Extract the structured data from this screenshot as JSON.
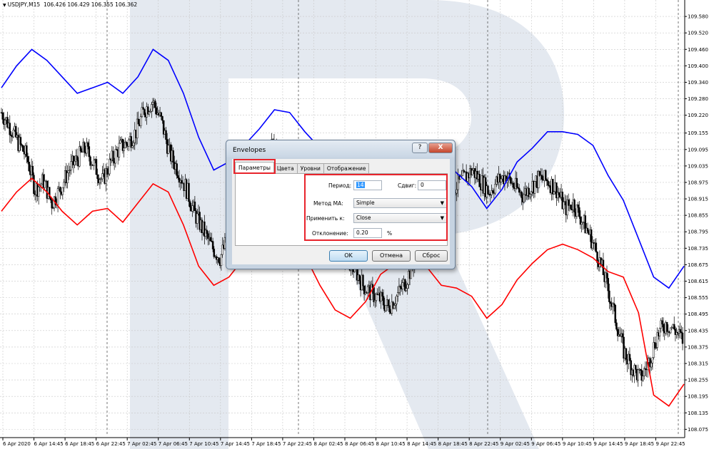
{
  "chart": {
    "symbol": "USDJPY,M15",
    "ohlc": "106.426 106.429 106.355 106.362",
    "colors": {
      "upper_band": "#0000ff",
      "lower_band": "#ff0000",
      "candles": "#000000",
      "grid": "#c8c8c8"
    }
  },
  "chart_data": {
    "type": "line",
    "ylim": [
      108.05,
      109.64
    ],
    "price_ticks": [
      "109.580",
      "109.520",
      "109.460",
      "109.400",
      "109.340",
      "109.280",
      "109.220",
      "109.155",
      "109.095",
      "109.035",
      "108.975",
      "108.915",
      "108.855",
      "108.795",
      "108.735",
      "108.675",
      "108.615",
      "108.555",
      "108.495",
      "108.435",
      "108.375",
      "108.315",
      "108.255",
      "108.195",
      "108.135",
      "108.075"
    ],
    "time_ticks": [
      "6 Apr 2020",
      "6 Apr 14:45",
      "6 Apr 18:45",
      "6 Apr 22:45",
      "7 Apr 02:45",
      "7 Apr 06:45",
      "7 Apr 10:45",
      "7 Apr 14:45",
      "7 Apr 18:45",
      "7 Apr 22:45",
      "8 Apr 02:45",
      "8 Apr 06:45",
      "8 Apr 10:45",
      "8 Apr 14:45",
      "8 Apr 18:45",
      "8 Apr 22:45",
      "9 Apr 02:45",
      "9 Apr 06:45",
      "9 Apr 10:45",
      "9 Apr 14:45",
      "9 Apr 18:45",
      "9 Apr 22:45"
    ],
    "series": [
      {
        "name": "",
        "color": "#0000ff",
        "values": [
          109.32,
          109.4,
          109.46,
          109.42,
          109.36,
          109.3,
          109.32,
          109.34,
          109.3,
          109.36,
          109.46,
          109.42,
          109.3,
          109.14,
          109.02,
          109.05,
          109.11,
          109.17,
          109.24,
          109.23,
          109.16,
          109.1,
          109.03,
          108.98,
          108.9,
          108.92,
          108.98,
          109.06,
          109.11,
          109.07,
          109.01,
          108.96,
          108.88,
          108.95,
          109.05,
          109.1,
          109.16,
          109.16,
          109.15,
          109.11,
          109.0,
          108.91,
          108.77,
          108.63,
          108.59,
          108.67
        ]
      },
      {
        "name": "",
        "color": "#ff0000",
        "values": [
          108.87,
          108.94,
          108.99,
          108.94,
          108.87,
          108.82,
          108.87,
          108.88,
          108.83,
          108.9,
          108.97,
          108.94,
          108.82,
          108.67,
          108.6,
          108.63,
          108.7,
          108.78,
          108.83,
          108.81,
          108.71,
          108.6,
          108.51,
          108.48,
          108.54,
          108.64,
          108.68,
          108.68,
          108.67,
          108.6,
          108.59,
          108.56,
          108.48,
          108.53,
          108.62,
          108.68,
          108.73,
          108.75,
          108.73,
          108.7,
          108.65,
          108.63,
          108.5,
          108.2,
          108.16,
          108.24
        ]
      }
    ],
    "candles_close": [
      109.23,
      109.18,
      109.12,
      109.07,
      108.95,
      108.98,
      108.9,
      108.95,
      109.02,
      109.06,
      109.1,
      109.04,
      108.98,
      109.05,
      109.1,
      109.12,
      109.16,
      109.24,
      109.27,
      109.2,
      109.08,
      109.02,
      108.95,
      108.86,
      108.8,
      108.74,
      108.7,
      108.78,
      108.86,
      108.92,
      108.98,
      109.05,
      109.12,
      109.1,
      109.02,
      108.96,
      108.9,
      108.86,
      108.8,
      108.76,
      108.72,
      108.7,
      108.66,
      108.6,
      108.57,
      108.55,
      108.52,
      108.56,
      108.61,
      108.68,
      108.76,
      108.83,
      108.88,
      108.92,
      108.96,
      108.99,
      109.02,
      108.98,
      108.94,
      108.98,
      109.0,
      108.96,
      108.93,
      108.96,
      108.99,
      108.98,
      108.95,
      108.88,
      108.9,
      108.84,
      108.78,
      108.7,
      108.6,
      108.48,
      108.36,
      108.3,
      108.26,
      108.32,
      108.42,
      108.46,
      108.44,
      108.4
    ]
  },
  "dialog": {
    "title": "Envelopes",
    "help": "?",
    "close": "X",
    "tabs": [
      "Параметры",
      "Цвета",
      "Уровни",
      "Отображение"
    ],
    "period_label": "Период:",
    "period_value": "14",
    "shift_label": "Сдвиг:",
    "shift_value": "0",
    "ma_method_label": "Метод МА:",
    "ma_method_value": "Simple",
    "apply_to_label": "Применить к:",
    "apply_to_value": "Close",
    "deviation_label": "Отклонение:",
    "deviation_value": "0.20",
    "deviation_unit": "%",
    "ok": "OK",
    "cancel": "Отмена",
    "reset": "Сброс",
    "highlight_color": "#e8242c"
  }
}
